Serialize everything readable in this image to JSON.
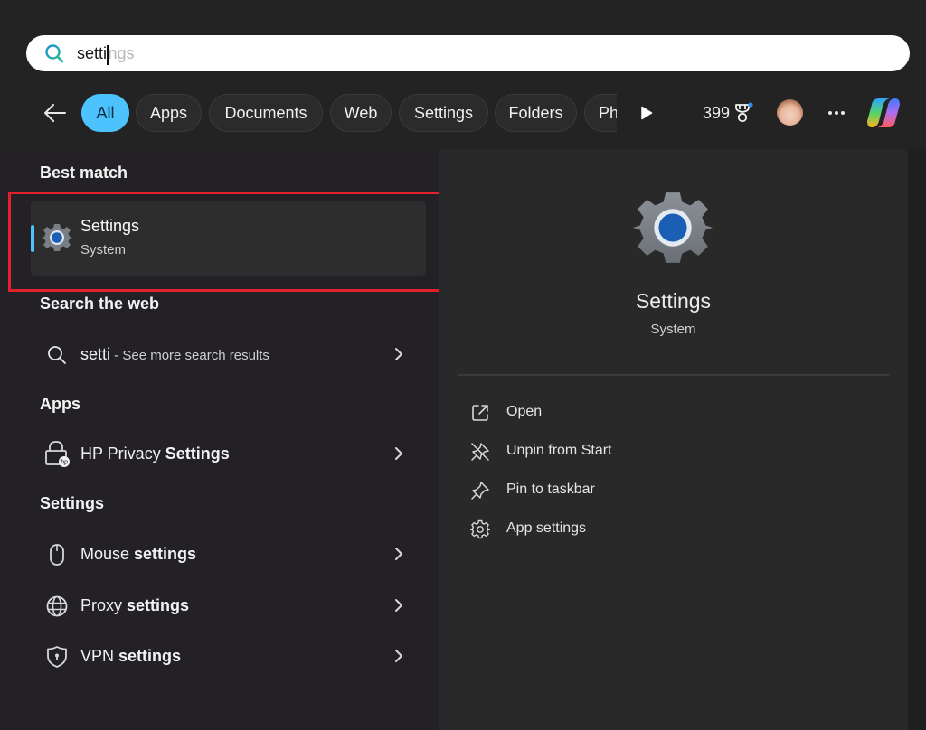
{
  "search": {
    "typed": "setti",
    "autocomplete_suffix": "ngs",
    "icon": "search-icon"
  },
  "filters": {
    "back_icon": "back-arrow-icon",
    "chips": [
      {
        "label": "All",
        "active": true
      },
      {
        "label": "Apps",
        "active": false
      },
      {
        "label": "Documents",
        "active": false
      },
      {
        "label": "Web",
        "active": false
      },
      {
        "label": "Settings",
        "active": false
      },
      {
        "label": "Folders",
        "active": false
      },
      {
        "label": "Ph",
        "active": false
      }
    ],
    "more_icon": "play-arrow-icon",
    "points": "399",
    "points_icon": "trophy-icon",
    "avatar_icon": "user-avatar",
    "menu_icon": "ellipsis-icon",
    "copilot_icon": "copilot-icon",
    "accent_color": "#4cc2ff"
  },
  "results": {
    "best_match": {
      "section": "Best match",
      "title": "Settings",
      "subtitle": "System",
      "icon": "settings-gear-icon",
      "highlight_color": "#e3202e"
    },
    "web": {
      "section": "Search the web",
      "query": "setti",
      "suffix": " - See more search results",
      "icon": "search-icon"
    },
    "apps": {
      "section": "Apps",
      "items": [
        {
          "prefix": "HP Privacy ",
          "match": "Settings",
          "icon": "hp-lock-icon"
        }
      ]
    },
    "settings": {
      "section": "Settings",
      "items": [
        {
          "prefix": "Mouse ",
          "match": "settings",
          "icon": "mouse-icon"
        },
        {
          "prefix": "Proxy ",
          "match": "settings",
          "icon": "globe-icon"
        },
        {
          "prefix": "VPN ",
          "match": "settings",
          "icon": "shield-icon"
        }
      ]
    }
  },
  "preview": {
    "title": "Settings",
    "subtitle": "System",
    "icon": "settings-gear-icon",
    "actions": [
      {
        "label": "Open",
        "icon": "open-external-icon"
      },
      {
        "label": "Unpin from Start",
        "icon": "unpin-icon"
      },
      {
        "label": "Pin to taskbar",
        "icon": "pin-icon"
      },
      {
        "label": "App settings",
        "icon": "gear-icon"
      }
    ]
  }
}
